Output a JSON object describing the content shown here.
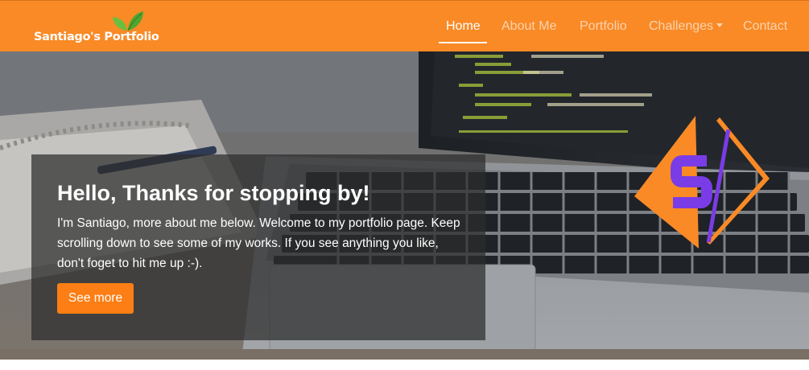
{
  "brand": {
    "name": "Santiago's Portfolio",
    "icon": "leaf-icon"
  },
  "nav": {
    "items": [
      {
        "label": "Home",
        "active": true
      },
      {
        "label": "About Me"
      },
      {
        "label": "Portfolio"
      },
      {
        "label": "Challenges",
        "dropdown": true
      },
      {
        "label": "Contact"
      }
    ]
  },
  "hero": {
    "title": "Hello, Thanks for stopping by!",
    "text": "I'm Santiago, more about me below. Welcome to my portfolio page. Keep scrolling down to see some of my works. If you see anything you like, don't foget to hit me up :-).",
    "button_label": "See more"
  },
  "logo": {
    "letter": "S",
    "icon": "code-slash-logo"
  },
  "colors": {
    "accent": "#f98a26",
    "button": "#fd7e14",
    "logo_purple": "#7a3ce6",
    "leaf_green": "#5db33a"
  }
}
